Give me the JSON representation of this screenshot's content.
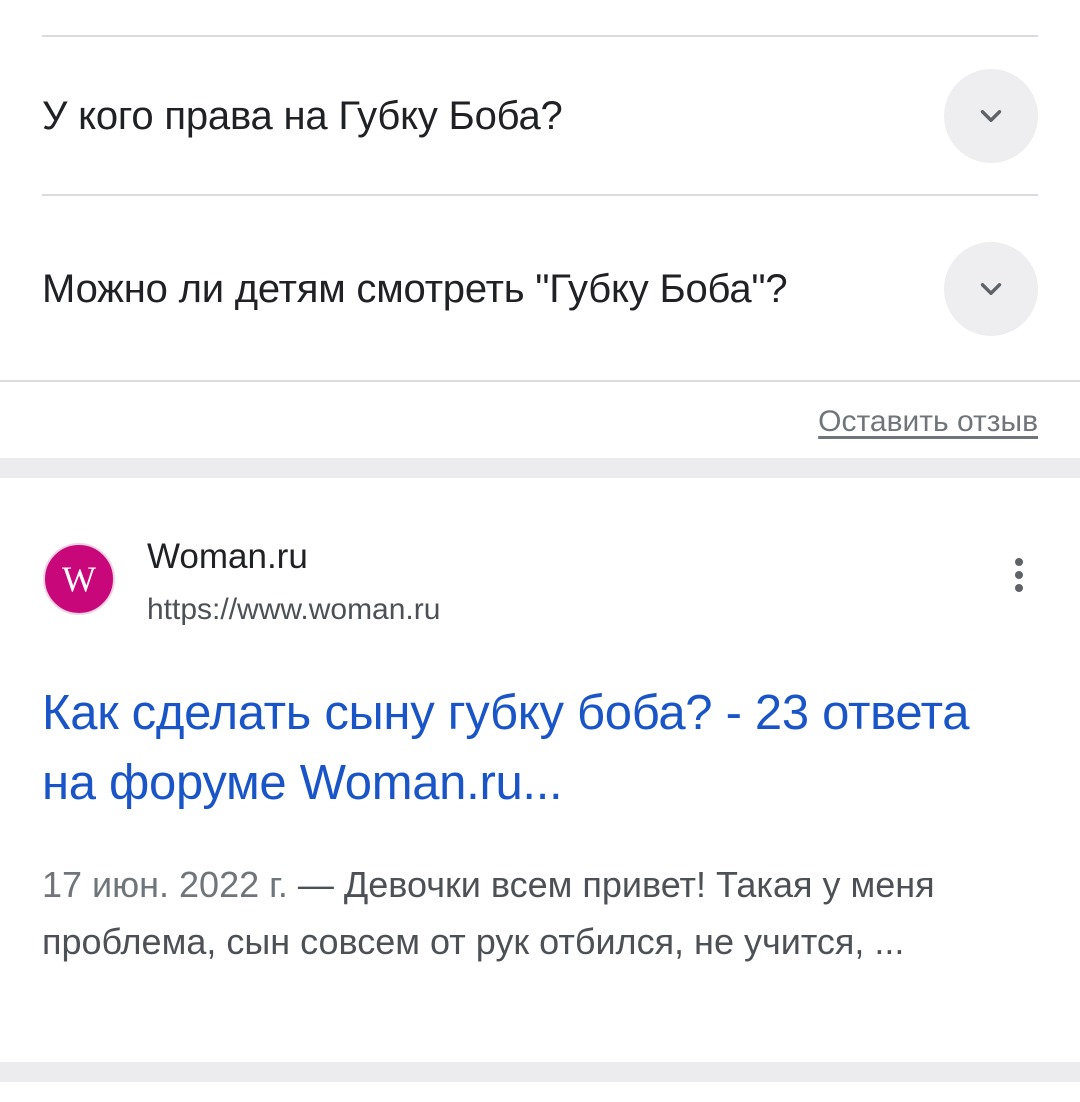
{
  "paa": {
    "questions": [
      {
        "text": "У кого права на Губку Боба?"
      },
      {
        "text": "Можно ли детям смотреть \"Губку Боба\"?"
      }
    ],
    "feedback_label": "Оставить отзыв"
  },
  "result": {
    "favicon_letter": "W",
    "favicon_color": "#c8087a",
    "site_name": "Woman.ru",
    "site_url": "https://www.woman.ru",
    "title": "Как сделать сыну губку боба? - 23 ответа на форуме Woman.ru...",
    "snippet_date": "17 июн. 2022 г.",
    "snippet_separator": " — ",
    "snippet_text": "Девочки всем привет! Такая у меня проблема, сын совсем от рук отбился, не учится, ...",
    "menu_icon": "more-vert-icon"
  },
  "colors": {
    "link": "#1a55c8",
    "divider": "#dadce0",
    "band": "#ececef"
  }
}
